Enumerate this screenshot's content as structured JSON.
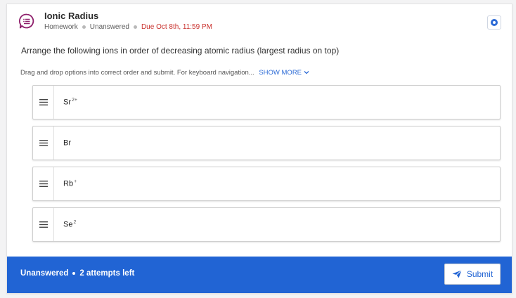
{
  "question": {
    "title": "Ionic Radius",
    "type": "Homework",
    "status": "Unanswered",
    "due": "Due Oct 8th, 11:59 PM",
    "icon": "question-list-icon",
    "prompt": "Arrange the following ions in order of decreasing atomic radius (largest radius on top)",
    "instructions": "Drag and drop options into correct order and submit. For keyboard navigation...",
    "show_more": "SHOW MORE"
  },
  "options": [
    {
      "base": "Sr",
      "charge": "2+"
    },
    {
      "base": "Br",
      "charge": ""
    },
    {
      "base": "Rb",
      "charge": "+"
    },
    {
      "base": "Se",
      "charge": "2"
    }
  ],
  "footer": {
    "status": "Unanswered",
    "attempts": "2 attempts left",
    "submit_label": "Submit"
  },
  "colors": {
    "accent": "#2164d4",
    "due": "#c9302c",
    "icon": "#8e1f6b"
  }
}
